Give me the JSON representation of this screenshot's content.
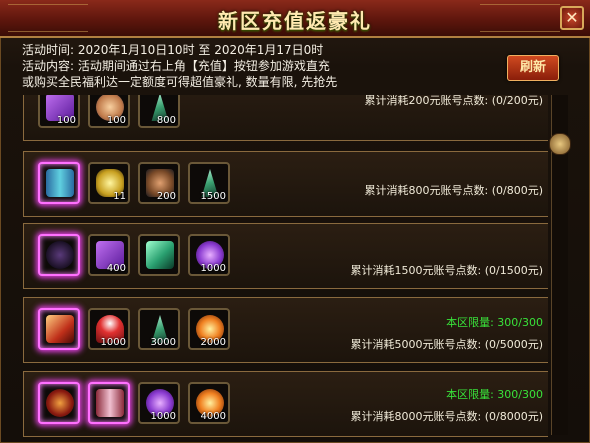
{
  "window": {
    "title": "新区充值返豪礼",
    "close_glyph": "✕"
  },
  "info": {
    "time_line": "活动时间: 2020年1月10日10时 至 2020年1月17日0时",
    "content_line1": "活动内容: 活动期间通过右上角【充值】按钮参加游戏直充",
    "content_line2": "或购买全民福利达一定额度可得超值豪礼, 数量有限, 先抢先"
  },
  "refresh_label": "刷新",
  "colors": {
    "limit_text": "#39e23a",
    "glow": "#ff70ff"
  },
  "rewards": [
    {
      "progress": "累计消耗200元账号点数: (0/200元)",
      "limit": "",
      "items": [
        {
          "icon": "purple-book-icon",
          "count": "100",
          "glow": false
        },
        {
          "icon": "hero-portrait-icon",
          "count": "100",
          "glow": false
        },
        {
          "icon": "green-crystal-icon",
          "count": "800",
          "glow": false
        }
      ]
    },
    {
      "progress": "累计消耗800元账号点数: (0/800元)",
      "limit": "",
      "items": [
        {
          "icon": "jade-banner-icon",
          "count": "",
          "glow": true
        },
        {
          "icon": "gold-ore-icon",
          "count": "11",
          "glow": false
        },
        {
          "icon": "warrior-portrait-icon",
          "count": "200",
          "glow": false
        },
        {
          "icon": "green-crystal-icon",
          "count": "1500",
          "glow": false
        }
      ]
    },
    {
      "progress": "累计消耗1500元账号点数: (0/1500元)",
      "limit": "",
      "items": [
        {
          "icon": "dark-mount-icon",
          "count": "",
          "glow": true
        },
        {
          "icon": "purple-book-icon",
          "count": "400",
          "glow": false
        },
        {
          "icon": "jade-block-icon",
          "count": "",
          "glow": false
        },
        {
          "icon": "purple-gem-icon",
          "count": "1000",
          "glow": false
        }
      ]
    },
    {
      "progress": "累计消耗5000元账号点数: (0/5000元)",
      "limit": "本区限量: 300/300",
      "items": [
        {
          "icon": "red-scroll-icon",
          "count": "",
          "glow": true
        },
        {
          "icon": "mushroom-icon",
          "count": "1000",
          "glow": false
        },
        {
          "icon": "green-crystal-icon",
          "count": "3000",
          "glow": false
        },
        {
          "icon": "flame-orb-icon",
          "count": "2000",
          "glow": false
        }
      ]
    },
    {
      "progress": "累计消耗8000元账号点数: (0/8000元)",
      "limit": "本区限量: 300/300",
      "items": [
        {
          "icon": "red-shield-icon",
          "count": "",
          "glow": true
        },
        {
          "icon": "wing-emblem-icon",
          "count": "",
          "glow": true
        },
        {
          "icon": "purple-gem-icon",
          "count": "1000",
          "glow": false
        },
        {
          "icon": "flame-orb-icon",
          "count": "4000",
          "glow": false
        }
      ]
    }
  ]
}
